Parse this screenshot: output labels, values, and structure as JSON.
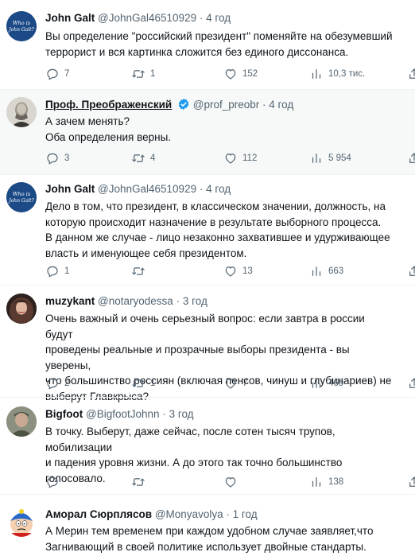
{
  "tweets": [
    {
      "name": "John Galt",
      "handle": "@JohnGal46510929",
      "time": "4 год",
      "dot": "·",
      "lines": [
        "Вы определение \"российский президент\" поменяйте на обезумевший",
        "террорист и вся картинка сложится без единого диссонанса."
      ],
      "reply_count": "7",
      "retweet_count": "1",
      "like_count": "152",
      "view_count": "10,3 тис.",
      "avatar_text": "Who is John Galt?"
    },
    {
      "name": "Проф. Преображенский",
      "handle": "@prof_preobr",
      "time": "4 год",
      "dot": "·",
      "verified": true,
      "lines": [
        "А зачем менять?",
        "Оба определения верны."
      ],
      "reply_count": "3",
      "retweet_count": "4",
      "like_count": "112",
      "view_count": "5 954"
    },
    {
      "name": "John Galt",
      "handle": "@JohnGal46510929",
      "time": "4 год",
      "dot": "·",
      "lines": [
        "Дело в том, что президент, в классическом значении, должность, на",
        "которую происходит назначение в результате выборного процесса.",
        "В данном же случае - лицо незаконно захватившее и удурживающее",
        "власть и именующее себя президентом."
      ],
      "reply_count": "1",
      "retweet_count": "",
      "like_count": "13",
      "view_count": "663",
      "avatar_text": "Who is John Galt?"
    },
    {
      "name": "muzykant",
      "handle": "@notaryodessa",
      "time": "3 год",
      "dot": "·",
      "lines": [
        "Очень важный и очень серьезный вопрос: если завтра в россии будут",
        "проведены реальные и прозрачные выборы президента - вы уверены,",
        "что большинство россиян (включая пенсов, чинуш и глубинариев) не",
        "выберут Главкрыса?"
      ],
      "reply_count": "2",
      "retweet_count": "1",
      "like_count": "7",
      "view_count": "469"
    },
    {
      "name": "Bigfoot",
      "handle": "@BigfootJohnn",
      "time": "3 год",
      "dot": "·",
      "lines": [
        "В точку. Выберут, даже сейчас, после сотен тысяч трупов, мобилизации",
        "и падения уровня жизни. А до этого так точно большинство",
        "голосовало."
      ],
      "reply_count": "",
      "retweet_count": "",
      "like_count": "",
      "view_count": "138"
    },
    {
      "name": "Аморал Сюрплясов",
      "handle": "@Monyavolya",
      "time": "1 год",
      "dot": "·",
      "lines": [
        "А Мерин тем временем при каждом удобном случае заявляет,что",
        "Загнивающий в своей политике использует двойные стандарты."
      ]
    }
  ],
  "colors": {
    "text": "#0f1419",
    "meta": "#536471",
    "verified": "#1d9bf0",
    "highlight": "#f7f9f9"
  }
}
